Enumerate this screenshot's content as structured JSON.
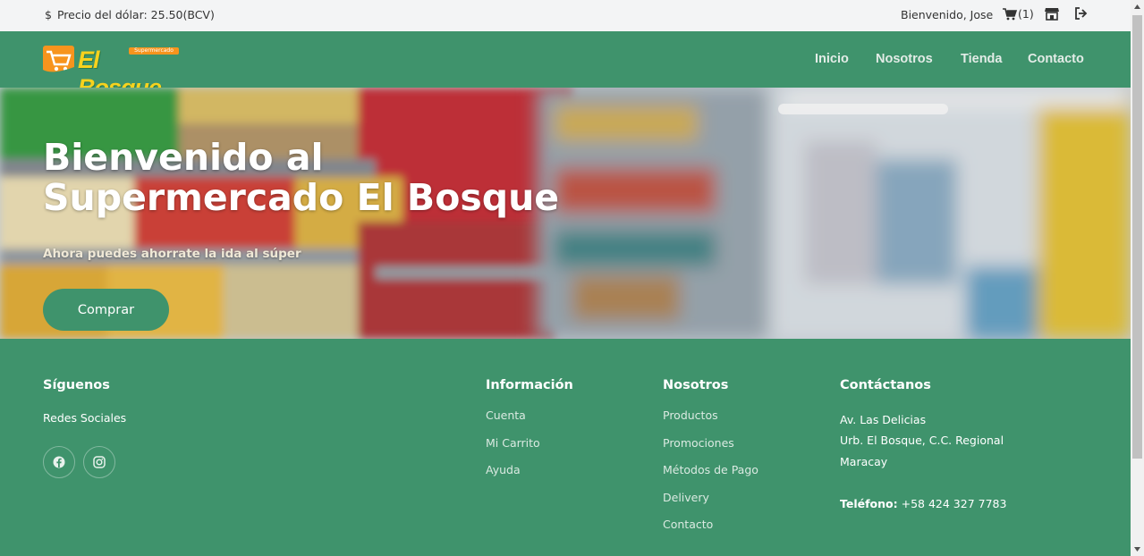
{
  "topbar": {
    "dollar_symbol": "$",
    "dollar_price": "Precio del dólar: 25.50(BCV)",
    "greeting": "Bienvenido, Jose",
    "cart_count": "(1)",
    "icons": [
      "cart-icon",
      "store-icon",
      "logout-icon"
    ]
  },
  "brand": {
    "logo_text": "El Bosque",
    "logo_tag": "Supermercado"
  },
  "nav": {
    "items": [
      "Inicio",
      "Nosotros",
      "Tienda",
      "Contacto"
    ]
  },
  "hero": {
    "title_line1": "Bienvenido al",
    "title_line2": "Supermercado El Bosque",
    "subtitle": "Ahora puedes ahorrate la ida al súper",
    "button": "Comprar"
  },
  "footer": {
    "follow": {
      "heading": "Síguenos",
      "text": "Redes Sociales",
      "icons": [
        "facebook-icon",
        "instagram-icon"
      ]
    },
    "info": {
      "heading": "Información",
      "links": [
        "Cuenta",
        "Mi Carrito",
        "Ayuda"
      ]
    },
    "about": {
      "heading": "Nosotros",
      "links": [
        "Productos",
        "Promociones",
        "Métodos de Pago",
        "Delivery",
        "Contacto"
      ]
    },
    "contact": {
      "heading": "Contáctanos",
      "address1": "Av. Las Delicias",
      "address2": "Urb. El Bosque, C.C. Regional",
      "city": "Maracay",
      "phone_label": "Teléfono:",
      "phone": "+58 424 327 7783"
    }
  },
  "colors": {
    "brand_green": "#3f936c",
    "topbar_bg": "#f3f4f5",
    "logo_orange": "#f7941d",
    "logo_yellow": "#f7d21e"
  }
}
